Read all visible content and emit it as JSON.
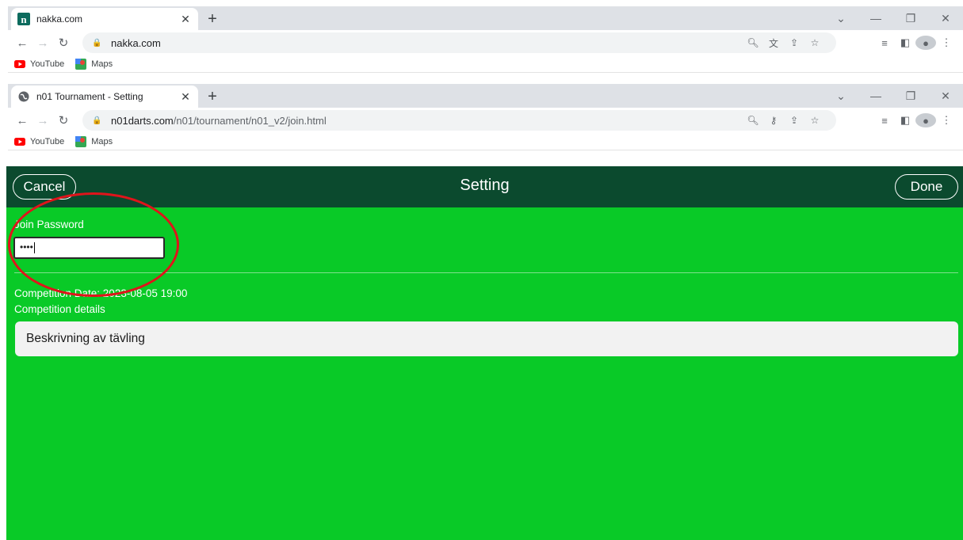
{
  "browser1": {
    "tab_title": "nakka.com",
    "url_host": "nakka.com",
    "url_path": "",
    "bookmarks": [
      "YouTube",
      "Maps"
    ]
  },
  "browser2": {
    "tab_title": "n01 Tournament - Setting",
    "url_host": "n01darts.com",
    "url_path": "/n01/tournament/n01_v2/join.html",
    "bookmarks": [
      "YouTube",
      "Maps"
    ]
  },
  "app": {
    "header_title": "Setting",
    "cancel_label": "Cancel",
    "done_label": "Done",
    "join_password_label": "Join Password",
    "join_password_value": "••••",
    "competition_date": "Competition Date: 2023-08-05 19:00",
    "competition_details_label": "Competition details",
    "competition_details_value": "Beskrivning av tävling"
  },
  "colors": {
    "header_bg": "#0b4a2e",
    "body_bg": "#09ca27",
    "annotation_ring": "#e0141b"
  }
}
